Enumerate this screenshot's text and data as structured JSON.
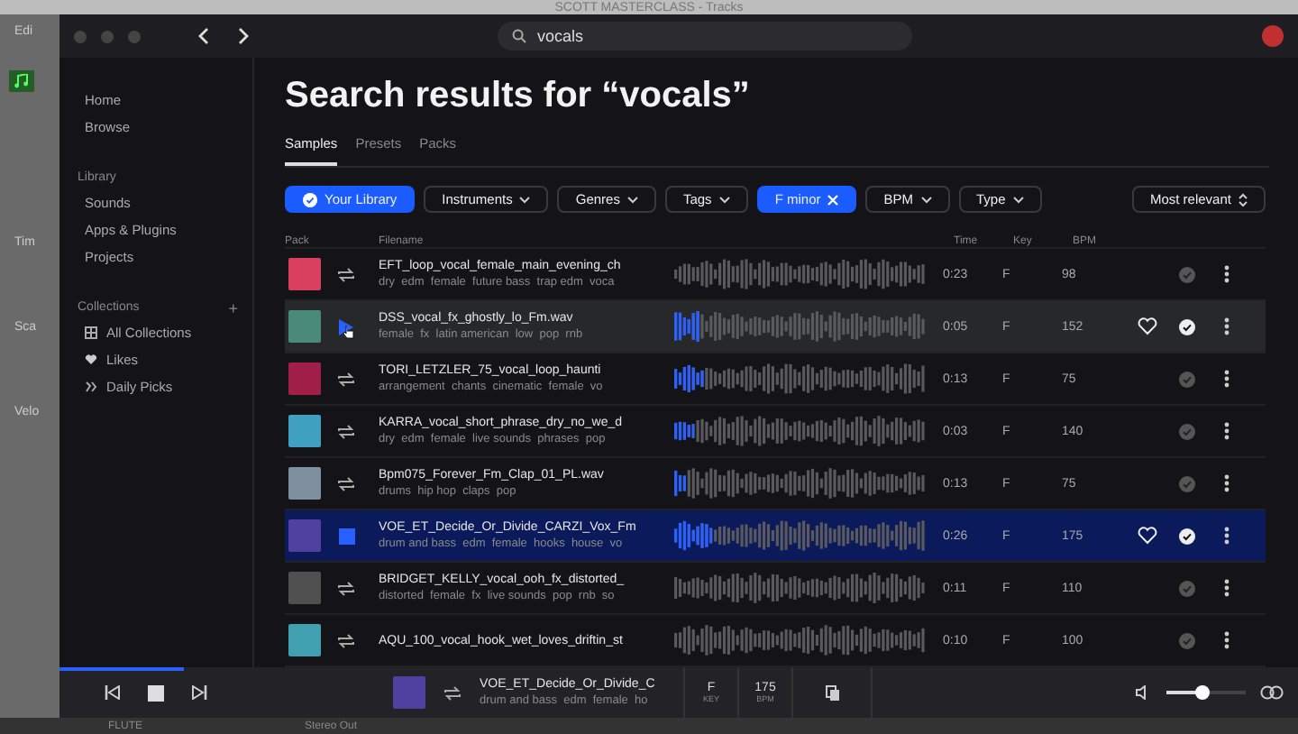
{
  "host_app": {
    "title": "SCOTT MASTERCLASS - Tracks",
    "side_labels": [
      "Edi",
      "Tim",
      "Sca",
      "Velo"
    ],
    "bottom_labels": [
      "FLUTE",
      "Stereo Out"
    ]
  },
  "search": {
    "value": "vocals"
  },
  "sidebar": {
    "items": [
      {
        "label": "Home"
      },
      {
        "label": "Browse"
      }
    ],
    "library": {
      "title": "Library",
      "items": [
        {
          "label": "Sounds"
        },
        {
          "label": "Apps & Plugins"
        },
        {
          "label": "Projects"
        }
      ]
    },
    "collections": {
      "title": "Collections",
      "add": "+",
      "items": [
        {
          "label": "All Collections",
          "kind": "grid"
        },
        {
          "label": "Likes",
          "kind": "heart"
        },
        {
          "label": "Daily Picks",
          "kind": "picks"
        }
      ]
    }
  },
  "heading": "Search results for “vocals”",
  "tabs": [
    {
      "label": "Samples",
      "selected": true
    },
    {
      "label": "Presets",
      "selected": false
    },
    {
      "label": "Packs",
      "selected": false
    }
  ],
  "filters": [
    {
      "label": "Your Library",
      "kind": "check",
      "selected": true
    },
    {
      "label": "Instruments",
      "kind": "menu",
      "selected": false
    },
    {
      "label": "Genres",
      "kind": "menu",
      "selected": false
    },
    {
      "label": "Tags",
      "kind": "menu",
      "selected": false
    },
    {
      "label": "F minor",
      "kind": "remove",
      "selected": true
    },
    {
      "label": "BPM",
      "kind": "menu",
      "selected": false
    },
    {
      "label": "Type",
      "kind": "menu",
      "selected": false
    }
  ],
  "sort": {
    "label": "Most relevant"
  },
  "table": {
    "columns": [
      "Pack",
      "Filename",
      "Time",
      "Key",
      "BPM"
    ],
    "rows": [
      {
        "filename": "EFT_loop_vocal_female_main_evening_ch",
        "tags": "dry  edm  female  future bass  trap edm  voca",
        "time": "0:23",
        "key": "F",
        "bpm": "98",
        "kind": "loop",
        "selected": false,
        "hovered": false,
        "color": "#d94060"
      },
      {
        "filename": "DSS_vocal_fx_ghostly_lo_Fm.wav",
        "tags": "female  fx  latin american  low  pop  rnb",
        "time": "0:05",
        "key": "F",
        "bpm": "152",
        "kind": "play",
        "selected": false,
        "hovered": true,
        "level": 0.1,
        "color": "#4a8a7a"
      },
      {
        "filename": "TORI_LETZLER_75_vocal_loop_haunti",
        "tags": "arrangement  chants  cinematic  female  vo",
        "time": "0:13",
        "key": "F",
        "bpm": "75",
        "kind": "loop",
        "selected": false,
        "hovered": false,
        "level": 0.12,
        "color": "#a0204a"
      },
      {
        "filename": "KARRA_vocal_short_phrase_dry_no_we_d",
        "tags": "dry  edm  female  live sounds  phrases  pop",
        "time": "0:03",
        "key": "F",
        "bpm": "140",
        "kind": "loop",
        "selected": false,
        "hovered": false,
        "level": 0.08,
        "color": "#40a0c0"
      },
      {
        "filename": "Bpm075_Forever_Fm_Clap_01_PL.wav",
        "tags": "drums  hip hop  claps  pop",
        "time": "0:13",
        "key": "F",
        "bpm": "75",
        "kind": "loop",
        "selected": false,
        "hovered": false,
        "level": 0.05,
        "color": "#8090a0"
      },
      {
        "filename": "VOE_ET_Decide_Or_Divide_CARZI_Vox_Fm",
        "tags": "drum and bass  edm  female  hooks  house  vo",
        "time": "0:26",
        "key": "F",
        "bpm": "175",
        "kind": "stop",
        "selected": true,
        "hovered": false,
        "level": 0.15,
        "color": "#5040a0"
      },
      {
        "filename": "BRIDGET_KELLY_vocal_ooh_fx_distorted_",
        "tags": "distorted  female  fx  live sounds  pop  rnb  so",
        "time": "0:11",
        "key": "F",
        "bpm": "110",
        "kind": "loop",
        "selected": false,
        "hovered": false,
        "color": "#505050"
      },
      {
        "filename": "AQU_100_vocal_hook_wet_loves_driftin_st",
        "time": "0:10",
        "key": "F",
        "bpm": "100",
        "kind": "loop",
        "selected": false,
        "hovered": false,
        "color": "#40a0b0"
      }
    ]
  },
  "player": {
    "level": 0.1,
    "filename": "VOE_ET_Decide_Or_Divide_C",
    "tags": "drum and bass  edm  female  ho",
    "key": "F",
    "key_label": "KEY",
    "bpm": "175",
    "bpm_label": "BPM",
    "volume": {
      "level": 0.45
    }
  }
}
